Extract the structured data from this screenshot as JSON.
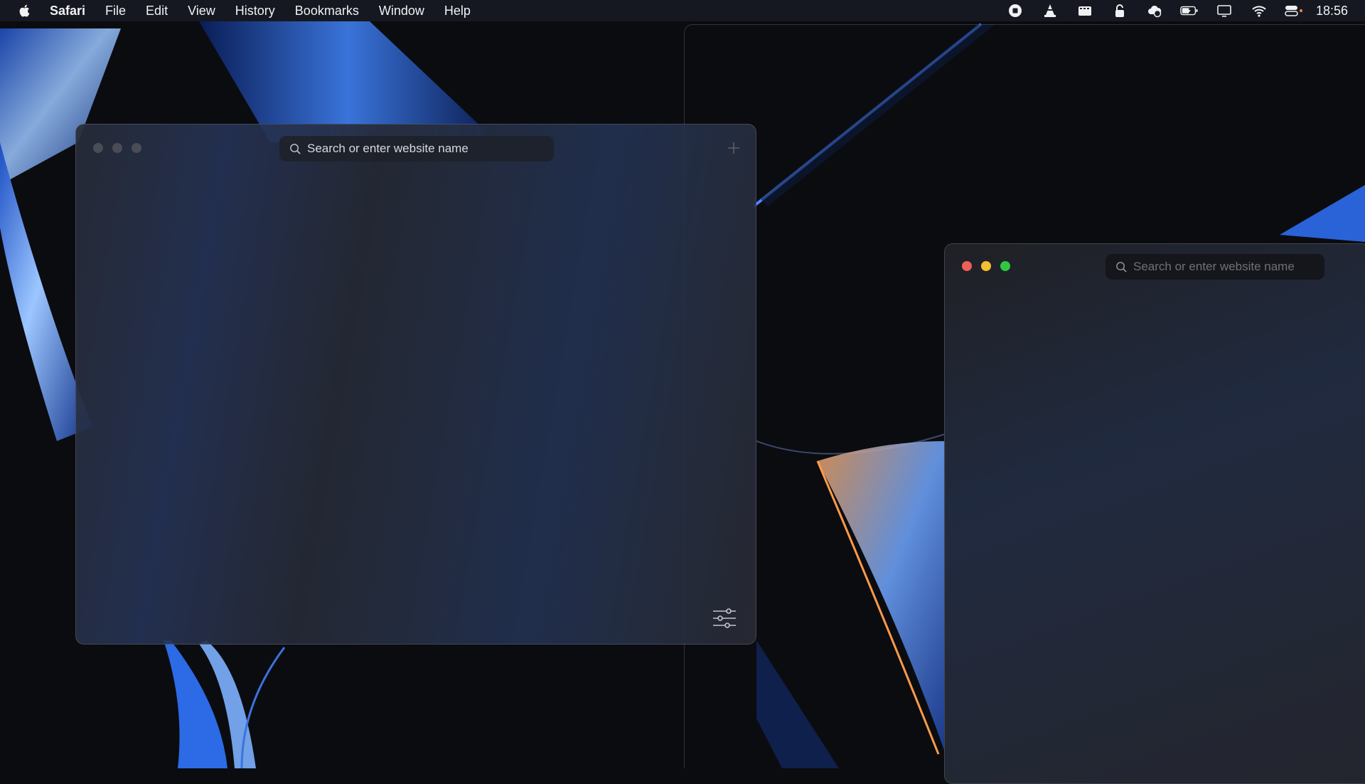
{
  "menubar": {
    "app_name": "Safari",
    "menus": [
      "File",
      "Edit",
      "View",
      "History",
      "Bookmarks",
      "Window",
      "Help"
    ],
    "status_icons": [
      "screen-record-icon",
      "vlc-icon",
      "clapper-icon",
      "lock-icon",
      "cloud-icon",
      "battery-charging-icon",
      "display-icon",
      "wifi-icon",
      "control-center-icon"
    ],
    "clock": "18:56"
  },
  "left_window": {
    "search_placeholder": "Search or enter website name",
    "new_tab_icon": "plus-icon",
    "customize_icon": "sliders-icon"
  },
  "right_window": {
    "search_placeholder": "Search or enter website name"
  },
  "colors": {
    "close": "#ee5f57",
    "minimize": "#f5bd2f",
    "zoom": "#2fc840"
  }
}
